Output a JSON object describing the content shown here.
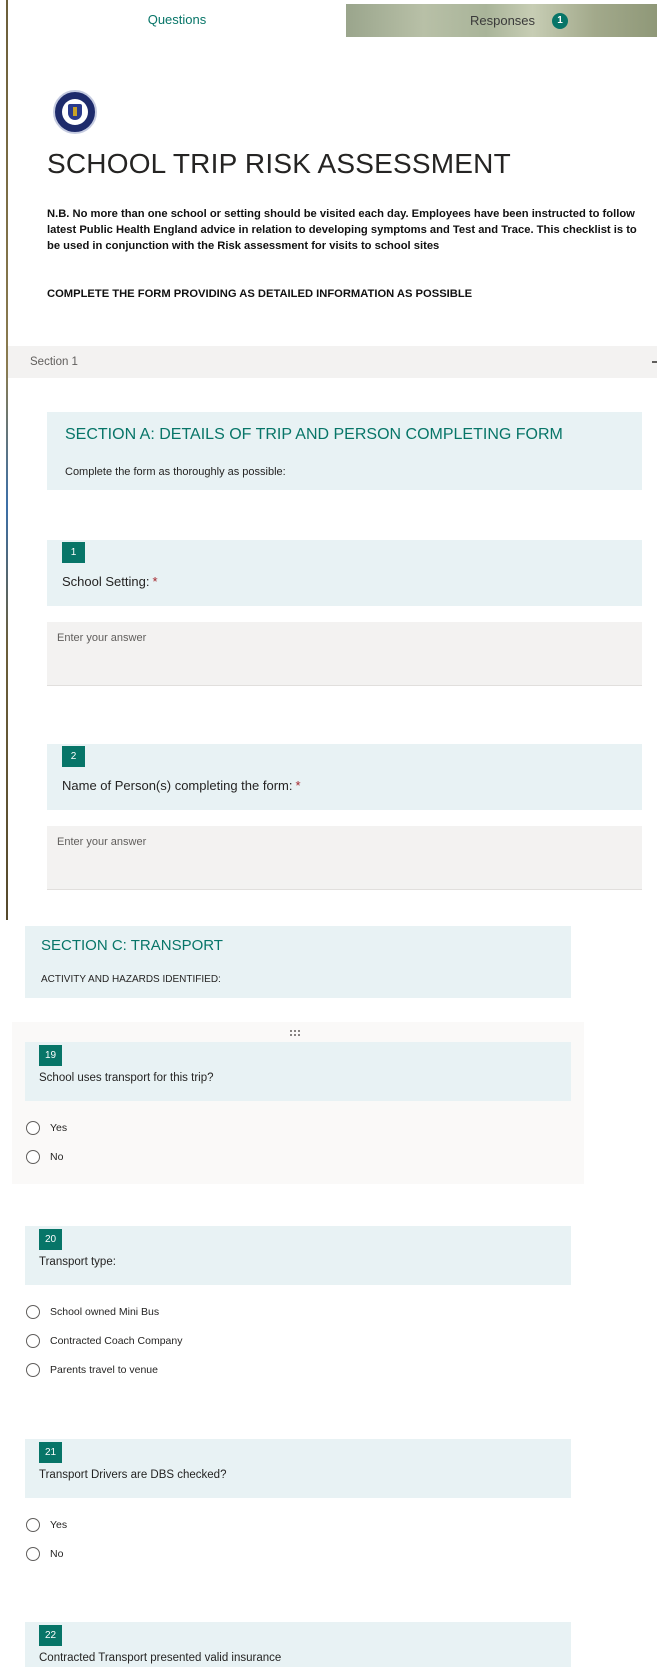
{
  "tabs": {
    "questions": "Questions",
    "responses": "Responses",
    "responses_count": "1"
  },
  "form": {
    "title": "SCHOOL TRIP RISK ASSESSMENT",
    "description": "N.B. No more than one school or setting should be visited each day. Employees have been instructed to follow latest Public Health England advice in relation to developing symptoms and Test and Trace. This checklist is to be used in conjunction with the Risk assessment for visits to school sites",
    "instruction": "COMPLETE THE FORM PROVIDING AS DETAILED INFORMATION AS POSSIBLE",
    "section_label": "Section 1"
  },
  "section_a": {
    "title": "SECTION A: DETAILS OF TRIP AND PERSON COMPLETING FORM",
    "subtitle": "Complete the form as thoroughly as possible:"
  },
  "questions_a": [
    {
      "number": "1",
      "text": "School Setting:",
      "required": "*",
      "placeholder": "Enter your answer"
    },
    {
      "number": "2",
      "text": "Name of Person(s) completing the form:",
      "required": "*",
      "placeholder": "Enter your answer"
    }
  ],
  "section_c": {
    "title": "SECTION C: TRANSPORT",
    "subtitle": "ACTIVITY AND HAZARDS IDENTIFIED:"
  },
  "questions_c": [
    {
      "number": "19",
      "text": "School uses transport for this trip?",
      "options": [
        "Yes",
        "No"
      ]
    },
    {
      "number": "20",
      "text": "Transport type:",
      "options": [
        "School owned Mini Bus",
        "Contracted Coach Company",
        "Parents travel to venue"
      ]
    },
    {
      "number": "21",
      "text": "Transport Drivers are DBS checked?",
      "options": [
        "Yes",
        "No"
      ]
    },
    {
      "number": "22",
      "text": "Contracted Transport presented valid insurance"
    }
  ],
  "colors": {
    "accent": "#077568",
    "panel": "#e8f2f4",
    "required": "#a4262c"
  }
}
